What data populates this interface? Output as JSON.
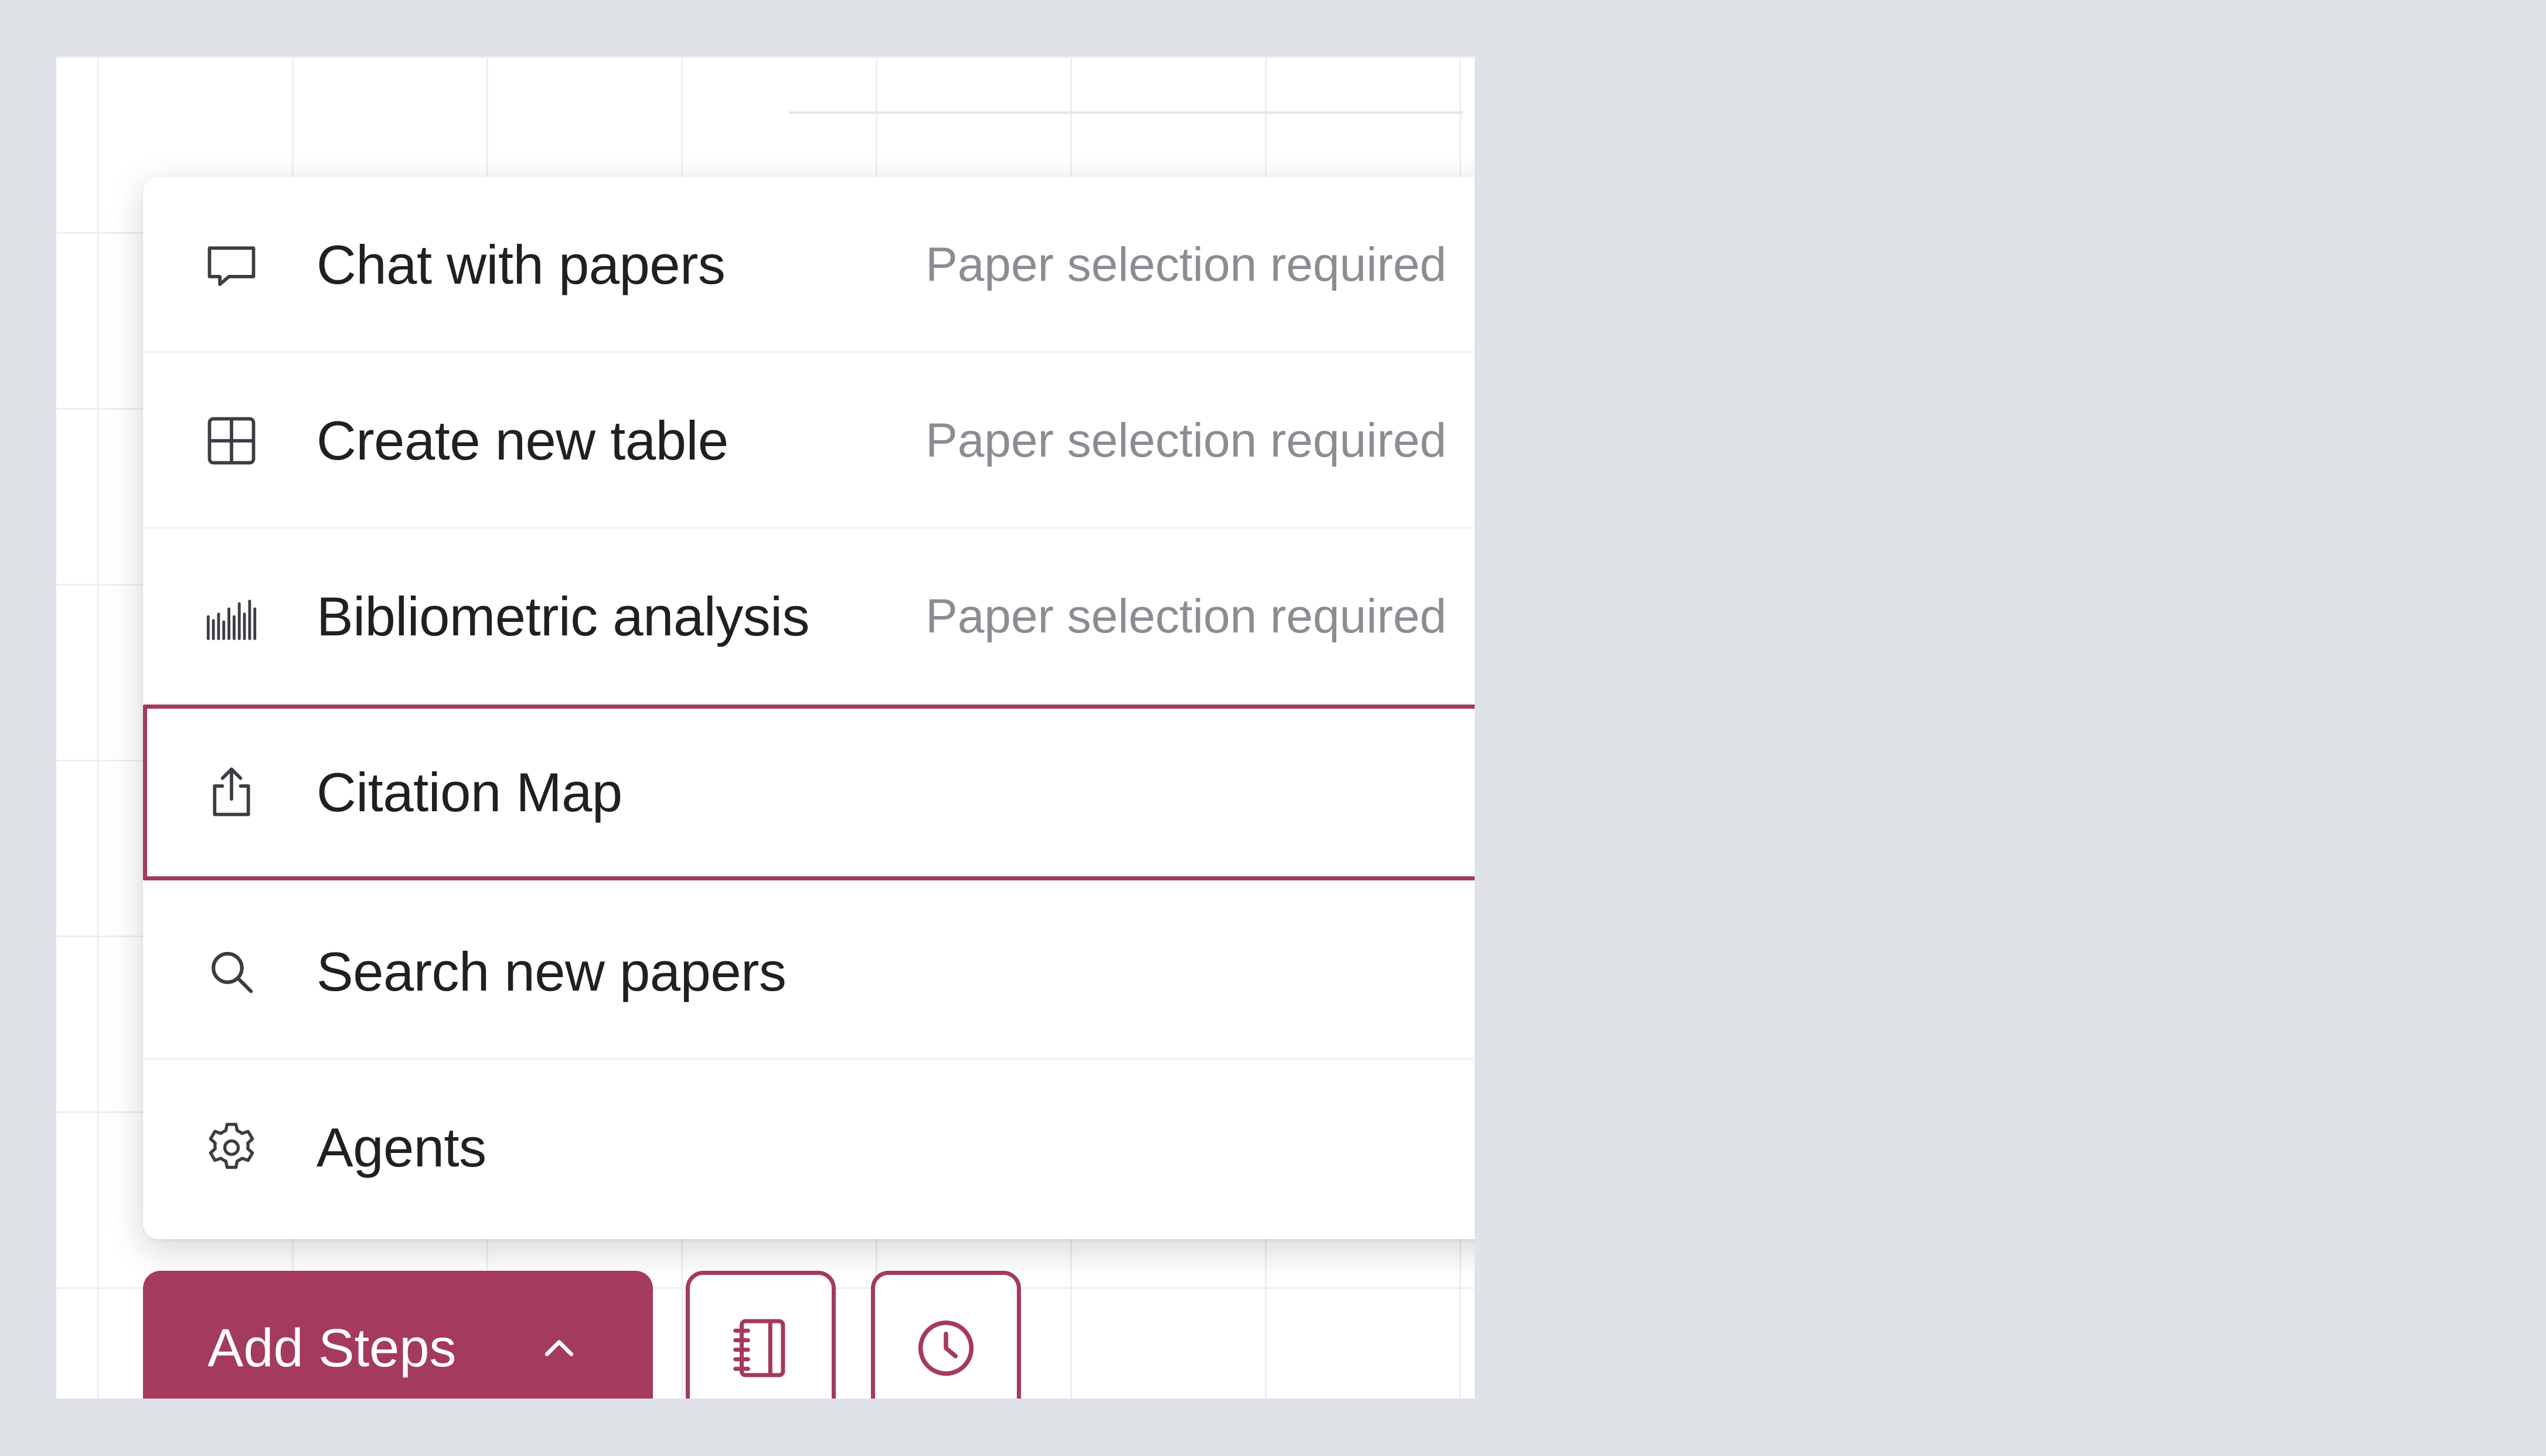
{
  "menu": {
    "items": [
      {
        "label": "Chat with papers",
        "hint": "Paper selection required",
        "icon": "chat-bubble-icon"
      },
      {
        "label": "Create new table",
        "hint": "Paper selection required",
        "icon": "table-grid-icon"
      },
      {
        "label": "Bibliometric analysis",
        "hint": "Paper selection required",
        "icon": "bar-chart-icon"
      },
      {
        "label": "Citation Map",
        "hint": "",
        "icon": "share-upload-icon",
        "selected": true
      },
      {
        "label": "Search new papers",
        "hint": "",
        "icon": "search-icon"
      },
      {
        "label": "Agents",
        "hint": "",
        "icon": "gear-icon"
      }
    ]
  },
  "toolbar": {
    "add_steps_label": "Add Steps",
    "add_steps_icon": "chevron-up-icon",
    "notebook_icon": "notebook-icon",
    "history_icon": "clock-icon"
  },
  "colors": {
    "accent": "#a43a5c",
    "page_background": "#dfe2e7",
    "text_primary": "#1f2024",
    "text_muted": "#8b8d93"
  }
}
